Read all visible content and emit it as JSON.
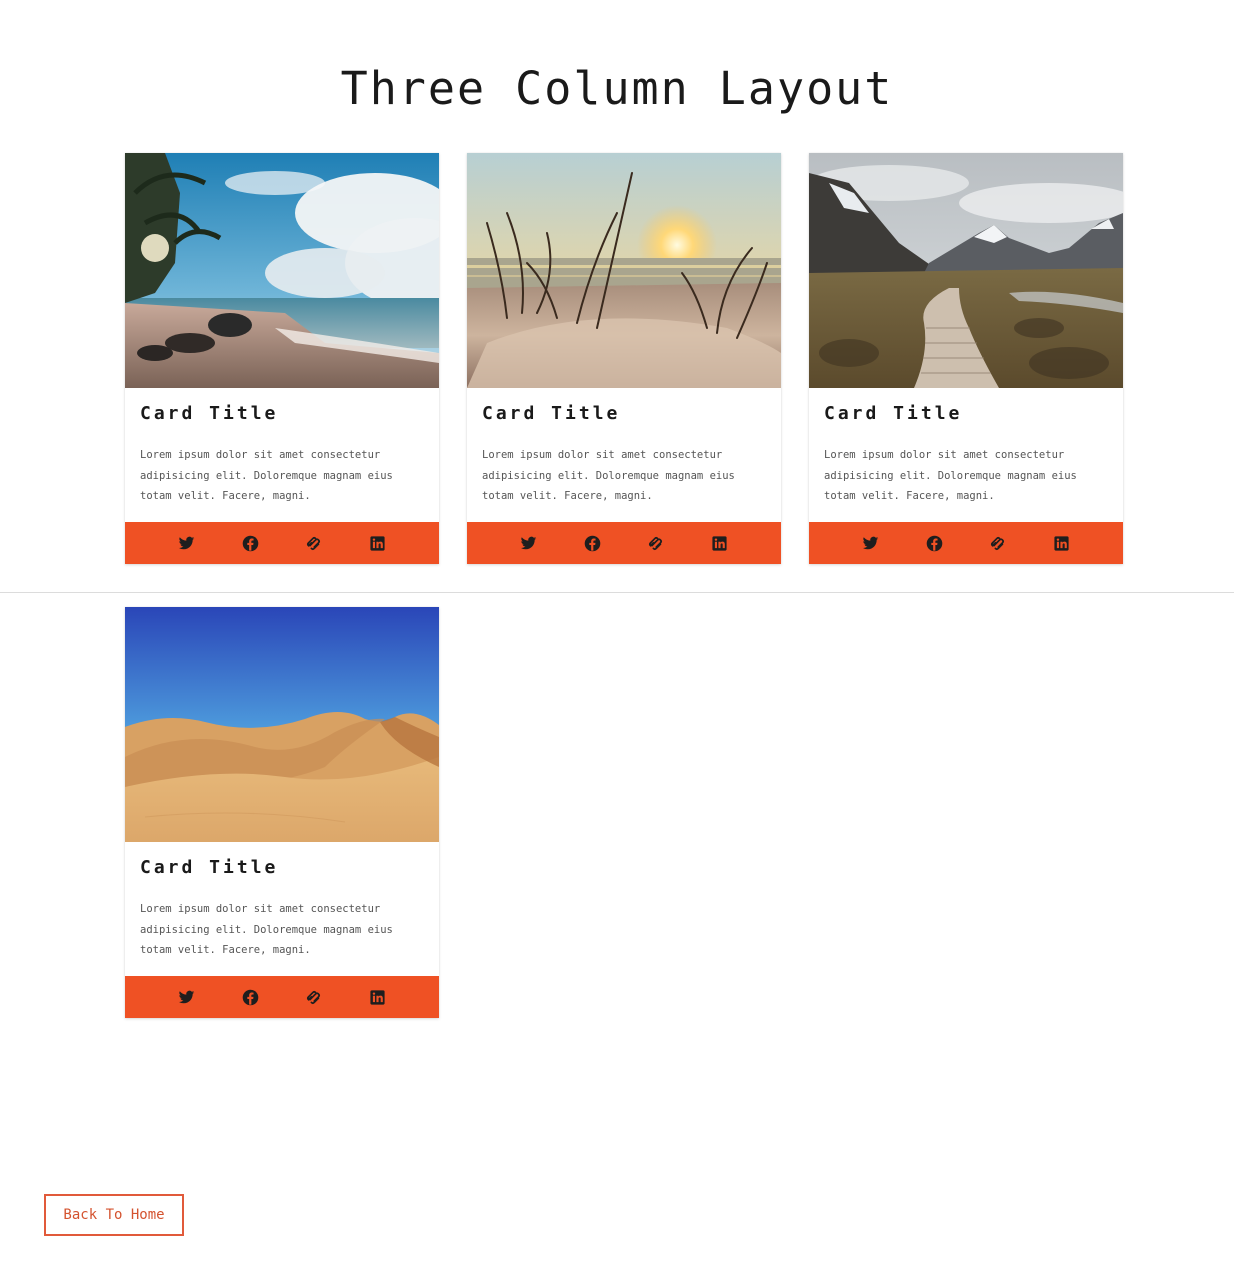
{
  "page": {
    "title": "Three Column Layout"
  },
  "theme": {
    "accent": "#ef5124",
    "button_border": "#e15a3a"
  },
  "cards": [
    {
      "image": "tropical-beach-photo",
      "title": "Card Title",
      "text": "Lorem ipsum dolor sit amet consectetur adipisicing elit. Doloremque magnam eius totam velit. Facere, magni.",
      "social": [
        "twitter-icon",
        "facebook-icon",
        "squarespace-icon",
        "linkedin-icon"
      ]
    },
    {
      "image": "sunset-dune-grass-photo",
      "title": "Card Title",
      "text": "Lorem ipsum dolor sit amet consectetur adipisicing elit. Doloremque magnam eius totam velit. Facere, magni.",
      "social": [
        "twitter-icon",
        "facebook-icon",
        "squarespace-icon",
        "linkedin-icon"
      ]
    },
    {
      "image": "mountain-boardwalk-photo",
      "title": "Card Title",
      "text": "Lorem ipsum dolor sit amet consectetur adipisicing elit. Doloremque magnam eius totam velit. Facere, magni.",
      "social": [
        "twitter-icon",
        "facebook-icon",
        "squarespace-icon",
        "linkedin-icon"
      ]
    },
    {
      "image": "desert-dunes-photo",
      "title": "Card Title",
      "text": "Lorem ipsum dolor sit amet consectetur adipisicing elit. Doloremque magnam eius totam velit. Facere, magni.",
      "social": [
        "twitter-icon",
        "facebook-icon",
        "squarespace-icon",
        "linkedin-icon"
      ]
    }
  ],
  "footer": {
    "back_label": "Back To Home"
  }
}
